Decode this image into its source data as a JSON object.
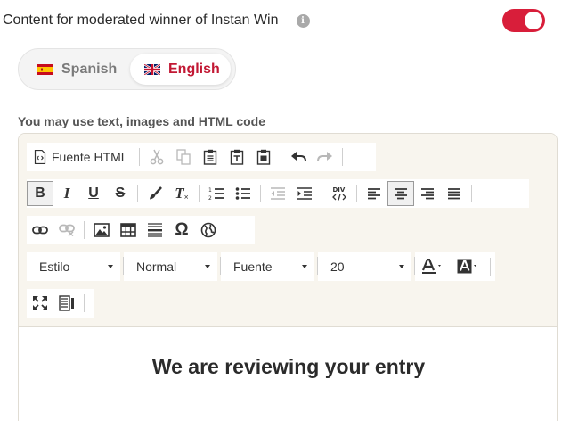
{
  "header": {
    "title": "Content for moderated winner of Instan Win",
    "info_glyph": "i",
    "toggle_on": true
  },
  "languages": {
    "items": [
      {
        "label": "Spanish",
        "flag": "spain-flag-icon",
        "selected": false
      },
      {
        "label": "English",
        "flag": "uk-flag-icon",
        "selected": true
      }
    ]
  },
  "helper_text": "You may use text, images and HTML code",
  "toolbar": {
    "source_label": "Fuente HTML",
    "combos": {
      "style": "Estilo",
      "format": "Normal",
      "font": "Fuente",
      "size": "20"
    },
    "glyphs": {
      "bold": "B",
      "italic": "I",
      "underline": "U",
      "strike": "S",
      "clear": "T",
      "omega": "Ω",
      "div": "DIV"
    }
  },
  "content": {
    "heading": "We are reviewing your entry"
  },
  "colors": {
    "accent": "#d81e3a",
    "english_tab": "#c21834",
    "toolbar_bg": "#f8f5ee"
  }
}
